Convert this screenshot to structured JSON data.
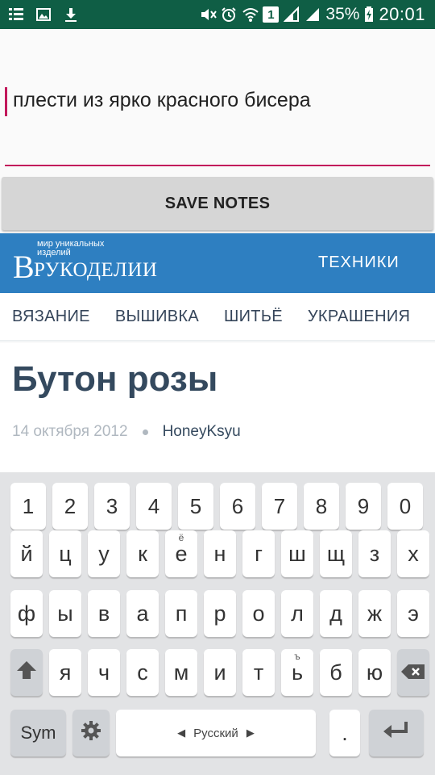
{
  "status_bar": {
    "battery_percent": "35%",
    "time": "20:01",
    "sim_badge": "1",
    "icons_left": [
      "grid-icon",
      "image-icon",
      "download-icon"
    ],
    "icons_right": [
      "mute-icon",
      "alarm-icon",
      "wifi-icon",
      "sim-icon",
      "signal-icon",
      "signal-icon-2",
      "battery-charging-icon"
    ]
  },
  "notes": {
    "input_value": "плести из ярко красного бисера",
    "save_button_label": "SAVE NOTES",
    "accent_color": "#c2185b"
  },
  "site": {
    "logo_tagline": "мир уникальных изделий",
    "logo_letter": "В",
    "logo_name": "РУКОДЕЛИИ",
    "header_link": "ТЕХНИКИ",
    "brand_color": "#2e7fc1",
    "categories": [
      "ВЯЗАНИЕ",
      "ВЫШИВКА",
      "ШИТЬЁ",
      "УКРАШЕНИЯ"
    ]
  },
  "article": {
    "title": "Бутон розы",
    "date": "14 октября 2012",
    "author": "HoneyKsyu"
  },
  "keyboard": {
    "row_numbers": [
      "1",
      "2",
      "3",
      "4",
      "5",
      "6",
      "7",
      "8",
      "9",
      "0"
    ],
    "row1": [
      "й",
      "ц",
      "у",
      "к",
      "е",
      "н",
      "г",
      "ш",
      "щ",
      "з",
      "х"
    ],
    "row1_hint_e": "ё",
    "row2": [
      "ф",
      "ы",
      "в",
      "а",
      "п",
      "р",
      "о",
      "л",
      "д",
      "ж",
      "э"
    ],
    "row3": [
      "я",
      "ч",
      "с",
      "м",
      "и",
      "т",
      "ь",
      "б",
      "ю"
    ],
    "row3_hint_soft": "ъ",
    "sym_label": "Sym",
    "language_label": "Русский",
    "period_label": "."
  }
}
